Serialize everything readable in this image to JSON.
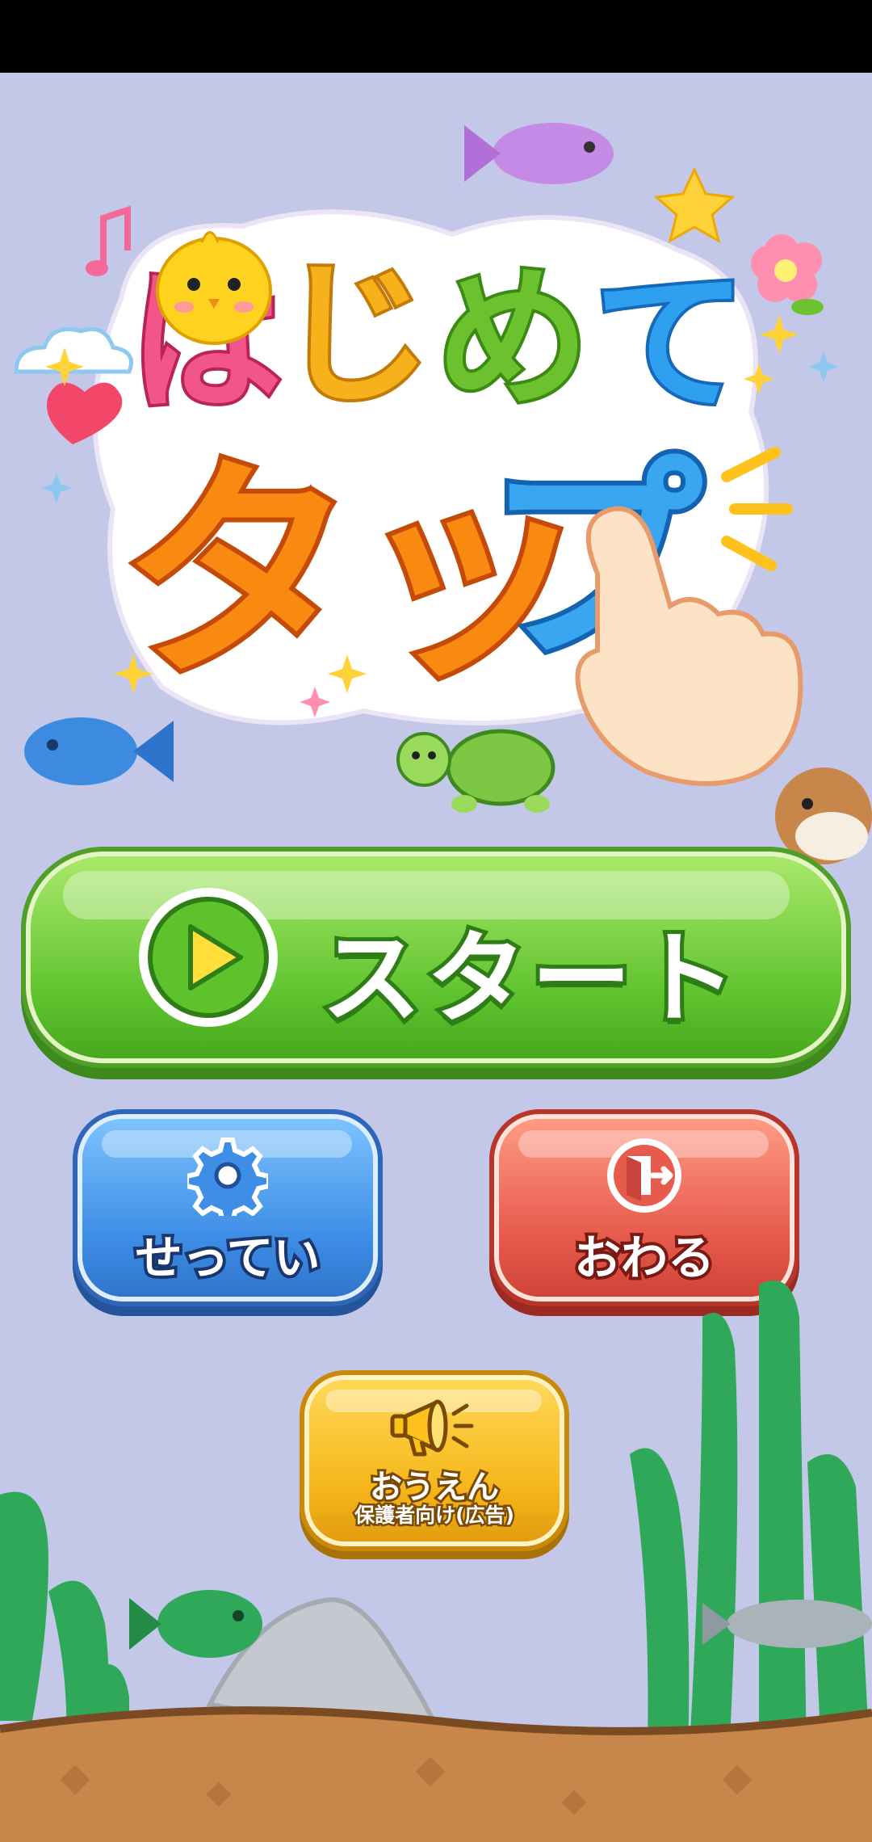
{
  "title": {
    "line1_chars": [
      "は",
      "じ",
      "め",
      "て"
    ],
    "line1_colors": [
      "#f2558a",
      "#f7b21b",
      "#6cc22e",
      "#2fa0ef"
    ],
    "line2": "タッ",
    "line2_mark": "プ",
    "line2_color": "#f88a12",
    "mark_color": "#3aa6f2"
  },
  "buttons": {
    "start": {
      "label": "スタート",
      "icon": "play-icon",
      "color": "#5ec22d"
    },
    "settings": {
      "label": "せってい",
      "icon": "gear-icon",
      "color": "#3f8ee6"
    },
    "exit": {
      "label": "おわる",
      "icon": "exit-door-icon",
      "color": "#e75b4c"
    },
    "support": {
      "label": "おうえん",
      "sublabel": "保護者向け(広告)",
      "icon": "megaphone-icon",
      "color": "#f5b81c"
    }
  },
  "colors": {
    "background": "#c3c8e8",
    "ground": "#c8874a",
    "seaweed": "#2fa85a"
  },
  "decorations": [
    "chick",
    "music-note",
    "cloud",
    "fish-purple",
    "star",
    "flower",
    "heart",
    "sparkles",
    "turtle",
    "fish-blue",
    "pufferfish",
    "hand-pointer",
    "fish-green",
    "fish-gray",
    "rock",
    "seaweed"
  ]
}
